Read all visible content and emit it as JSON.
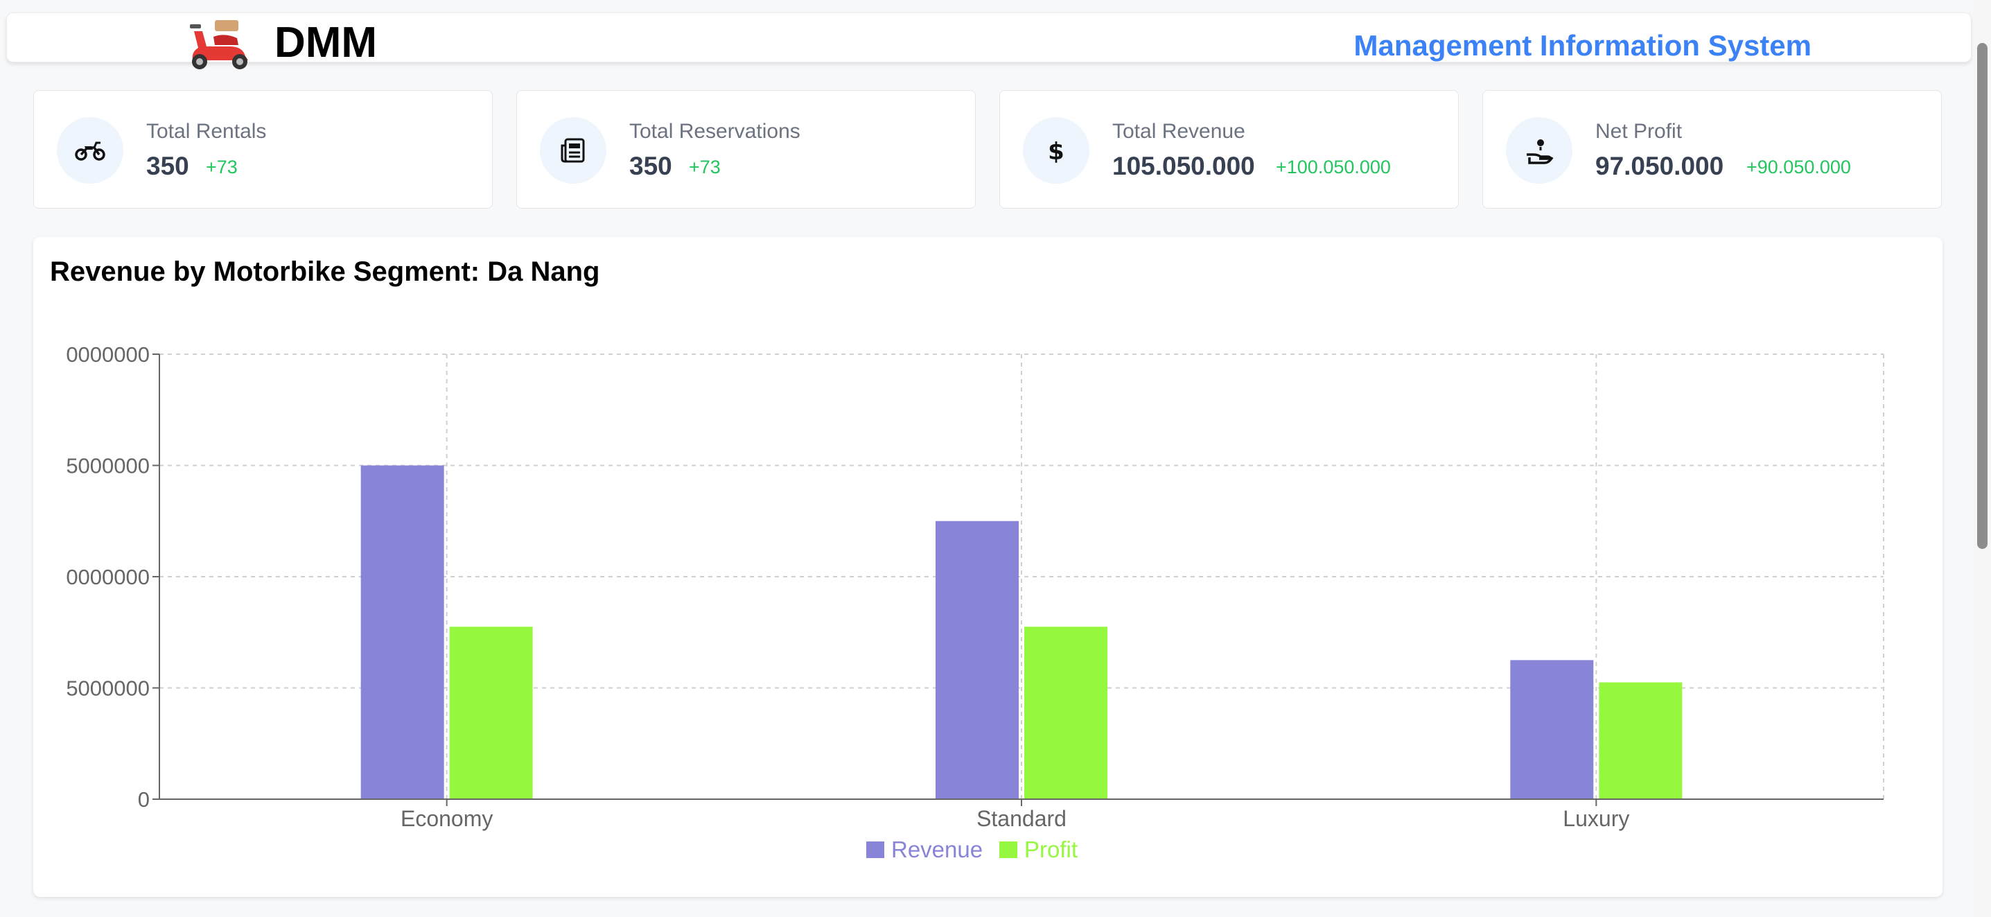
{
  "header": {
    "logo_text": "DMM",
    "title": "Management Information System"
  },
  "stats": [
    {
      "label": "Total Rentals",
      "value": "350",
      "delta": "+73",
      "icon": "motorbike-icon"
    },
    {
      "label": "Total Reservations",
      "value": "350",
      "delta": "+73",
      "icon": "newspaper-icon"
    },
    {
      "label": "Total Revenue",
      "value": "105.050.000",
      "delta": "+100.050.000",
      "icon": "dollar-icon"
    },
    {
      "label": "Net Profit",
      "value": "97.050.000",
      "delta": "+90.050.000",
      "icon": "hand-coin-icon"
    }
  ],
  "colors": {
    "accent": "#3b82f6",
    "positive": "#22c55e",
    "revenue": "#8884d8",
    "profit": "#96f73f"
  },
  "chart_data": {
    "type": "bar",
    "title": "Revenue by Motorbike Segment: Da Nang",
    "categories": [
      "Economy",
      "Standard",
      "Luxury"
    ],
    "series": [
      {
        "name": "Revenue",
        "values": [
          60000000,
          50000000,
          25000000
        ]
      },
      {
        "name": "Profit",
        "values": [
          31000000,
          31000000,
          21000000
        ]
      }
    ],
    "y_ticks": [
      "0",
      "5000000",
      "0000000",
      "5000000",
      "0000000"
    ],
    "ylim": [
      0,
      80000000
    ],
    "grid": true,
    "legend": "bottom"
  }
}
